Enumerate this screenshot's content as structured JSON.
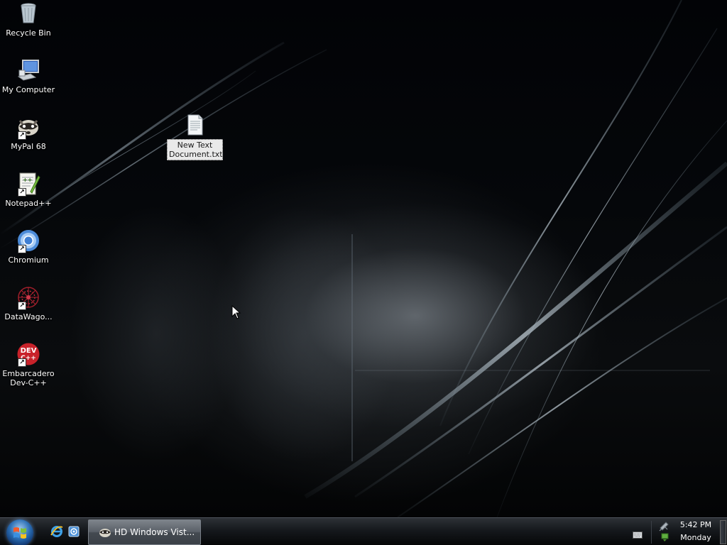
{
  "desktop": {
    "icons": [
      {
        "label": "Recycle Bin",
        "icon": "recycle-bin-icon",
        "shortcut": false
      },
      {
        "label": "My Computer",
        "icon": "my-computer-icon",
        "shortcut": false
      },
      {
        "label": "MyPal 68",
        "icon": "mypal-icon",
        "shortcut": true
      },
      {
        "label": "Notepad++",
        "icon": "notepadpp-icon",
        "shortcut": true
      },
      {
        "label": "Chromium",
        "icon": "chromium-icon",
        "shortcut": true
      },
      {
        "label": "DataWago...",
        "icon": "datawagon-icon",
        "shortcut": true
      },
      {
        "label": "Embarcadero Dev-C++",
        "icon": "devcpp-icon",
        "shortcut": true,
        "badge_text": "DEV"
      }
    ],
    "selected_file": {
      "label_line1": "New Text",
      "label_line2": "Document.txt",
      "icon": "text-file-icon"
    }
  },
  "taskbar": {
    "quick_launch": [
      {
        "icon": "internet-explorer-icon"
      },
      {
        "icon": "show-desktop-quicklaunch-icon"
      }
    ],
    "task_item": {
      "label": "HD Windows Vist...",
      "icon": "mypal-icon"
    },
    "tray": {
      "icons": [
        "keyboard-icon",
        "network-icon"
      ]
    },
    "clock": {
      "time": "5:42 PM",
      "day": "Monday"
    }
  },
  "colors": {
    "taskbar": "#15181c",
    "selection": "#e9e9e9",
    "start_orb": "#2a6db3"
  }
}
